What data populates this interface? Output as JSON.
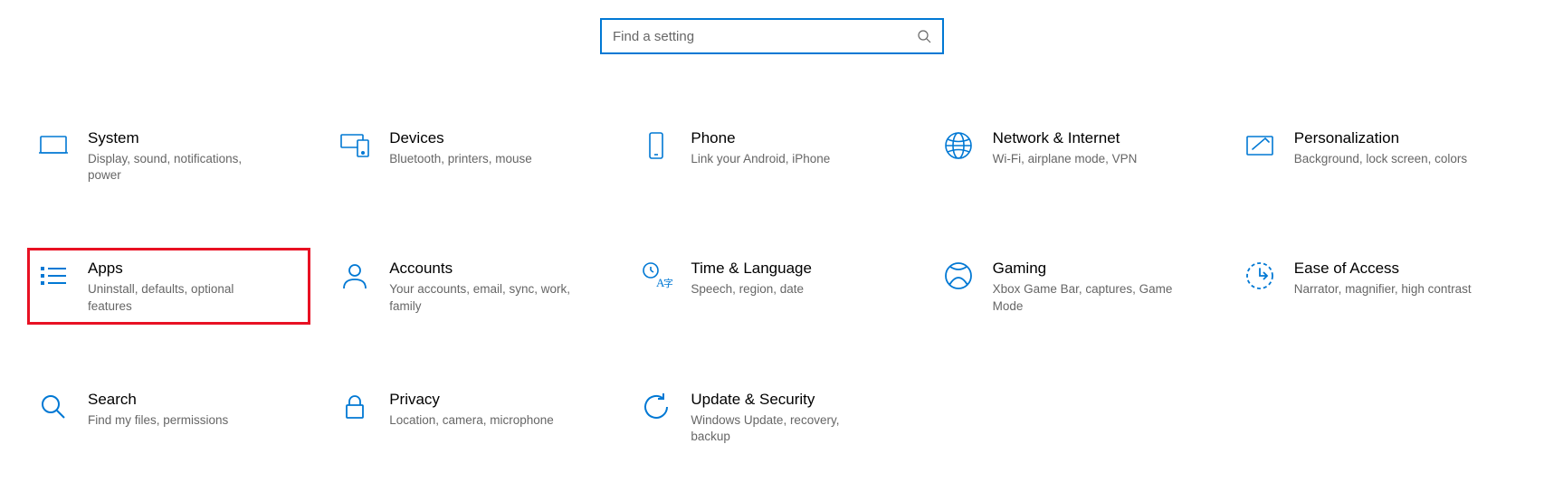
{
  "search": {
    "placeholder": "Find a setting"
  },
  "tiles": [
    {
      "id": "system",
      "title": "System",
      "desc": "Display, sound, notifications, power",
      "highlight": false
    },
    {
      "id": "devices",
      "title": "Devices",
      "desc": "Bluetooth, printers, mouse",
      "highlight": false
    },
    {
      "id": "phone",
      "title": "Phone",
      "desc": "Link your Android, iPhone",
      "highlight": false
    },
    {
      "id": "network",
      "title": "Network & Internet",
      "desc": "Wi-Fi, airplane mode, VPN",
      "highlight": false
    },
    {
      "id": "personalization",
      "title": "Personalization",
      "desc": "Background, lock screen, colors",
      "highlight": false
    },
    {
      "id": "apps",
      "title": "Apps",
      "desc": "Uninstall, defaults, optional features",
      "highlight": true
    },
    {
      "id": "accounts",
      "title": "Accounts",
      "desc": "Your accounts, email, sync, work, family",
      "highlight": false
    },
    {
      "id": "time",
      "title": "Time & Language",
      "desc": "Speech, region, date",
      "highlight": false
    },
    {
      "id": "gaming",
      "title": "Gaming",
      "desc": "Xbox Game Bar, captures, Game Mode",
      "highlight": false
    },
    {
      "id": "ease",
      "title": "Ease of Access",
      "desc": "Narrator, magnifier, high contrast",
      "highlight": false
    },
    {
      "id": "search",
      "title": "Search",
      "desc": "Find my files, permissions",
      "highlight": false
    },
    {
      "id": "privacy",
      "title": "Privacy",
      "desc": "Location, camera, microphone",
      "highlight": false
    },
    {
      "id": "update",
      "title": "Update & Security",
      "desc": "Windows Update, recovery, backup",
      "highlight": false
    }
  ],
  "colors": {
    "accent": "#0078d4",
    "highlight_border": "#e81123"
  }
}
